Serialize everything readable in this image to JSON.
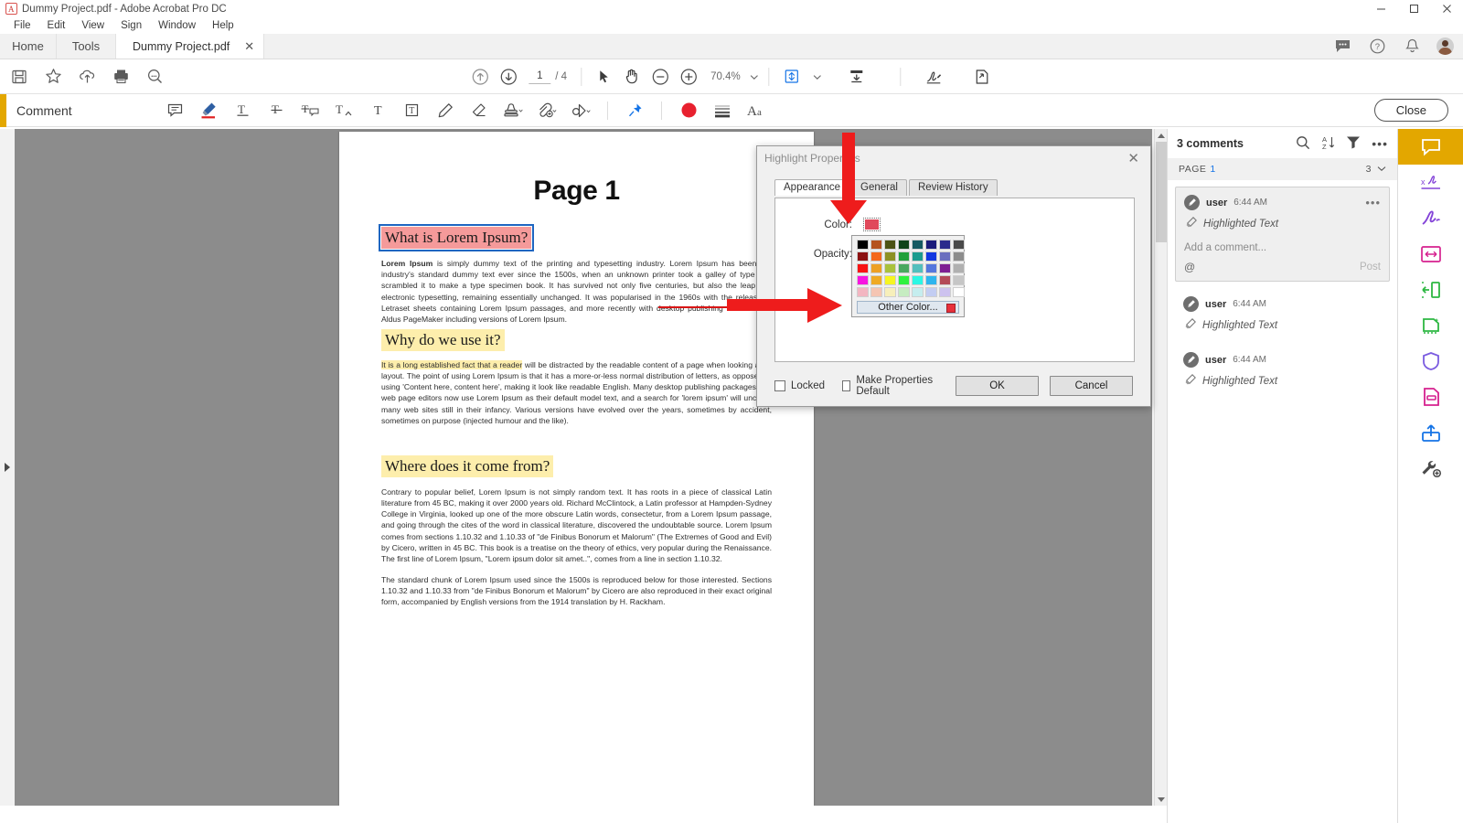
{
  "window": {
    "title": "Dummy Project.pdf - Adobe Acrobat Pro DC",
    "minimize": "–",
    "maximize": "□",
    "close": "✕"
  },
  "menu": {
    "items": [
      "File",
      "Edit",
      "View",
      "Sign",
      "Window",
      "Help"
    ]
  },
  "tabs": {
    "home": "Home",
    "tools": "Tools",
    "document": "Dummy Project.pdf",
    "document_close": "✕"
  },
  "toolbar": {
    "left_icons": [
      "save-icon",
      "star-icon",
      "upload-cloud-icon",
      "print-icon",
      "search-zoom-icon"
    ],
    "page_current": "1",
    "page_total": "/ 4",
    "zoom_level": "70.4%",
    "center_icons": [
      "previous-page-icon",
      "next-page-icon",
      "select-tool-icon",
      "hand-tool-icon",
      "zoom-out-icon",
      "zoom-in-icon",
      "fit-page-icon",
      "scroll-mode-icon",
      "sign-icon",
      "share-doc-icon"
    ]
  },
  "comment_bar": {
    "title": "Comment",
    "close_label": "Close",
    "tools": [
      "sticky-note-icon",
      "highlight-text-icon",
      "underline-text-icon",
      "strikethrough-text-icon",
      "replace-text-icon",
      "insert-text-icon",
      "add-text-icon",
      "text-box-icon",
      "draw-freehand-icon",
      "erase-icon",
      "stamp-icon",
      "attach-file-icon",
      "add-shape-icon",
      "pin-icon",
      "color-swatch-icon",
      "line-thickness-icon",
      "text-properties-icon"
    ]
  },
  "titlebar_right": [
    "chat-icon",
    "help-icon",
    "notification-bell-icon",
    "user-avatar"
  ],
  "document": {
    "page_heading": "Page 1",
    "sections": [
      {
        "heading": "What is Lorem Ipsum?",
        "heading_highlight": "pink",
        "selected": true,
        "body_lead": "Lorem Ipsum",
        "body": " is simply dummy text of the printing and typesetting industry. Lorem Ipsum has been the industry's standard dummy text ever since the 1500s, when an unknown printer took a galley of type and scrambled it to make a type specimen book. It has survived not only five centuries, but also the leap into electronic typesetting, remaining essentially unchanged. It was popularised in the 1960s with the release of Letraset sheets containing Lorem Ipsum passages, and more recently with desktop publishing software like Aldus PageMaker including versions of Lorem Ipsum."
      },
      {
        "heading": "Why do we use it?",
        "heading_highlight": "yellow",
        "selected": false,
        "body_highlighted": "It is a long established fact that a reader",
        "body": " will be distracted by the readable content of a page when looking at its layout. The point of using Lorem Ipsum is that it has a more-or-less normal distribution of letters, as opposed to using 'Content here, content here', making it look like readable English. Many desktop publishing packages and web page editors now use Lorem Ipsum as their default model text, and a search for 'lorem ipsum' will uncover many web sites still in their infancy. Various versions have evolved over the years, sometimes by accident, sometimes on purpose (injected humour and the like)."
      },
      {
        "heading": "Where does it come from?",
        "heading_highlight": "yellow",
        "selected": false,
        "body": "Contrary to popular belief, Lorem Ipsum is not simply random text. It has roots in a piece of classical Latin literature from 45 BC, making it over 2000 years old. Richard McClintock, a Latin professor at Hampden-Sydney College in Virginia, looked up one of the more obscure Latin words, consectetur, from a Lorem Ipsum passage, and going through the cites of the word in classical literature, discovered the undoubtable source. Lorem Ipsum comes from sections 1.10.32 and 1.10.33 of \"de Finibus Bonorum et Malorum\" (The Extremes of Good and Evil) by Cicero, written in 45 BC. This book is a treatise on the theory of ethics, very popular during the Renaissance. The first line of Lorem Ipsum, \"Lorem ipsum dolor sit amet..\", comes from a line in section 1.10.32.",
        "body2": "The standard chunk of Lorem Ipsum used since the 1500s is reproduced below for those interested. Sections 1.10.32 and 1.10.33 from \"de Finibus Bonorum et Malorum\" by Cicero are also reproduced in their exact original form, accompanied by English versions from the 1914 translation by H. Rackham."
      }
    ]
  },
  "comments_panel": {
    "count_label": "3 comments",
    "header_icons": [
      "search-icon",
      "sort-az-icon",
      "filter-icon",
      "more-options-icon"
    ],
    "page_group": {
      "label": "PAGE",
      "number": "1",
      "count": "3",
      "chevron": "⌄"
    },
    "items": [
      {
        "user": "user",
        "time": "6:44 AM",
        "type": "Highlighted Text",
        "expanded": true,
        "comment_placeholder": "Add a comment...",
        "mention": "@",
        "post_label": "Post",
        "more": "•••"
      },
      {
        "user": "user",
        "time": "6:44 AM",
        "type": "Highlighted Text",
        "expanded": false
      },
      {
        "user": "user",
        "time": "6:44 AM",
        "type": "Highlighted Text",
        "expanded": false
      }
    ]
  },
  "rail": {
    "items": [
      {
        "name": "comment-tool",
        "active": true
      },
      {
        "name": "fill-and-sign-tool",
        "active": false
      },
      {
        "name": "request-signatures-tool",
        "active": false
      },
      {
        "name": "edit-pdf-tool",
        "active": false
      },
      {
        "name": "export-pdf-tool",
        "active": false
      },
      {
        "name": "create-pdf-tool",
        "active": false
      },
      {
        "name": "protect-tool",
        "active": false
      },
      {
        "name": "combine-files-tool",
        "active": false
      },
      {
        "name": "send-for-comments-tool",
        "active": false
      },
      {
        "name": "more-tools",
        "active": false
      }
    ]
  },
  "dialog": {
    "title": "Highlight Properties",
    "close": "✕",
    "tabs": [
      {
        "label": "Appearance",
        "active": true
      },
      {
        "label": "General",
        "active": false
      },
      {
        "label": "Review History",
        "active": false
      }
    ],
    "color_label": "Color:",
    "opacity_label": "Opacity:",
    "current_color": "#e0495b",
    "locked_label": "Locked",
    "make_default_label": "Make Properties Default",
    "ok_label": "OK",
    "cancel_label": "Cancel",
    "color_picker": {
      "other_color_label": "Other Color...",
      "current_swatch": "#e8303b",
      "rows": [
        [
          "#000000",
          "#b5521e",
          "#4c5314",
          "#0f4419",
          "#155a62",
          "#1b1b7a",
          "#2b2b8c",
          "#4a4a4a"
        ],
        [
          "#8b1111",
          "#f4671c",
          "#8d9123",
          "#21a03a",
          "#1b9b8e",
          "#1237e0",
          "#6b6fbf",
          "#8c8c8c"
        ],
        [
          "#f81313",
          "#eda024",
          "#a9c13c",
          "#4aa860",
          "#52bfbd",
          "#5577dd",
          "#7e1f93",
          "#b0b0b0"
        ],
        [
          "#f715e0",
          "#efaa24",
          "#f6f520",
          "#2ff13f",
          "#2bf7e4",
          "#2eb5ee",
          "#b44a59",
          "#c6c6c6"
        ],
        [
          "#f3b6c1",
          "#f5c5b2",
          "#f7efba",
          "#c6ecc1",
          "#c5edee",
          "#c3cdf2",
          "#cdc2ef",
          "#ffffff"
        ]
      ]
    }
  }
}
